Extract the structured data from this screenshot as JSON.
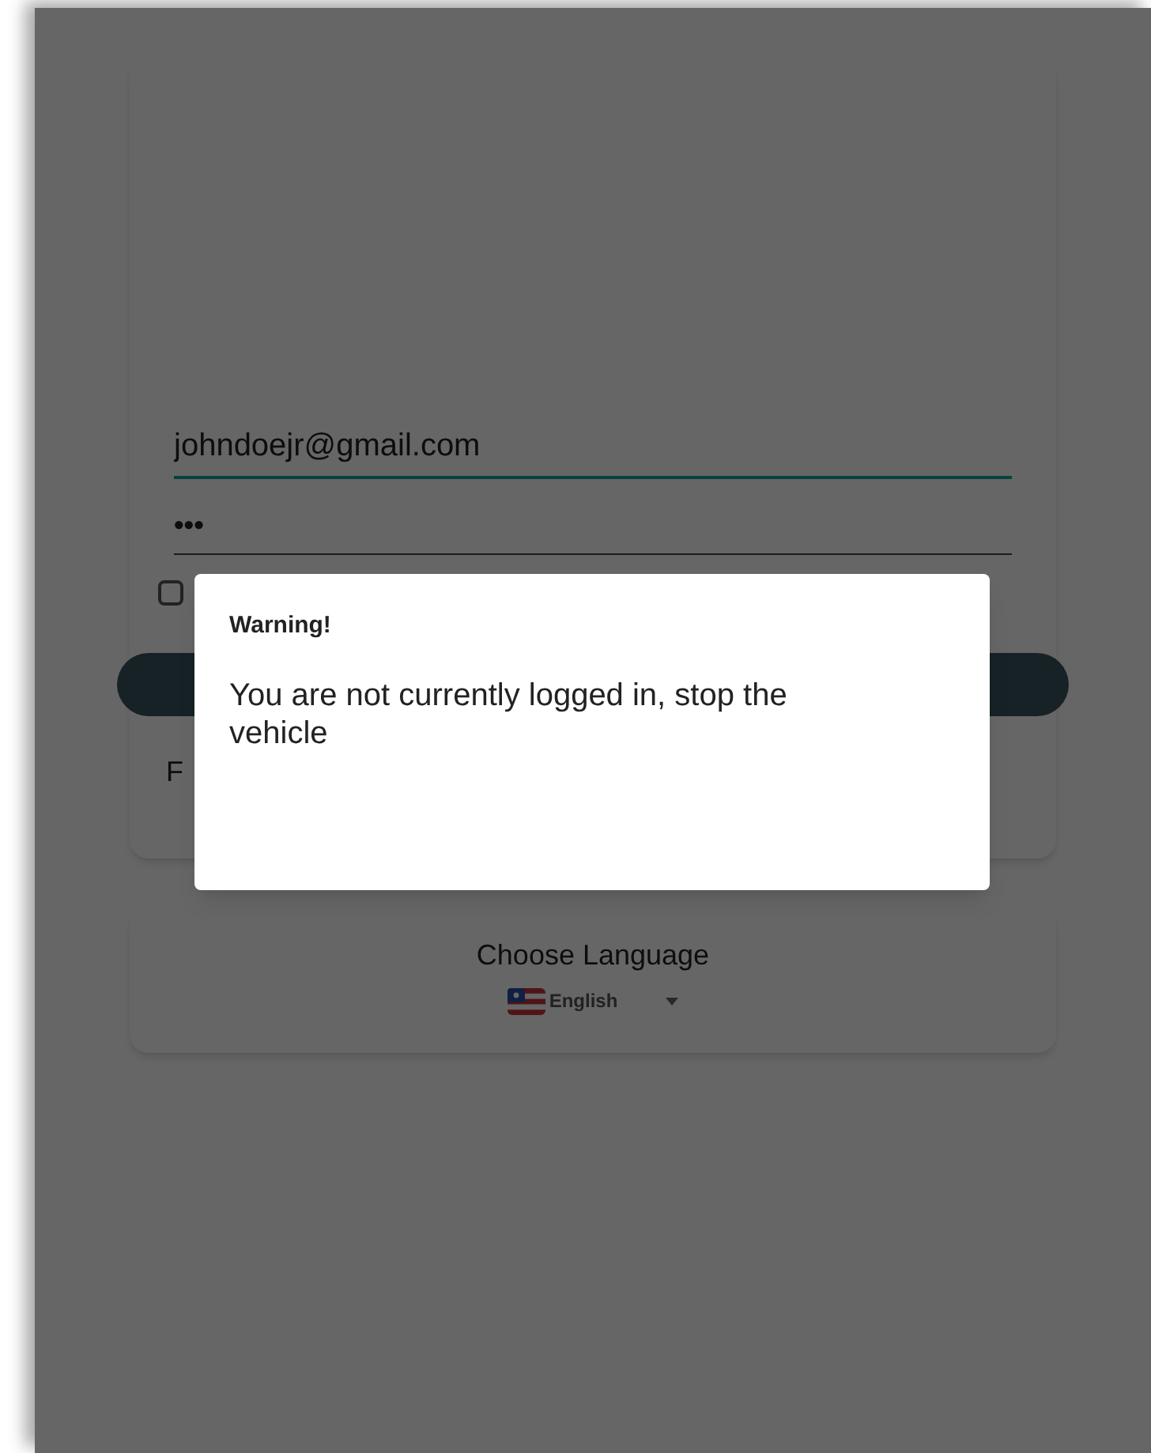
{
  "login_form": {
    "email": {
      "value": "johndoejr@gmail.com",
      "focused": true
    },
    "password": {
      "value": "•••"
    },
    "remember_checkbox": {
      "checked": false
    },
    "footer_text": "F"
  },
  "language_card": {
    "title": "Choose Language",
    "selected_language": "English"
  },
  "dialog": {
    "title": "Warning!",
    "message": "You are not currently logged in, stop the vehicle"
  }
}
